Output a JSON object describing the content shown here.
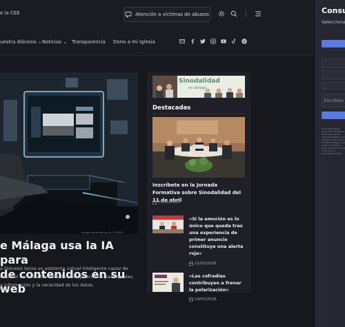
{
  "header": {
    "cee_link": "e la CEE",
    "victims_button": "Atención a víctimas de abusos"
  },
  "nav": {
    "items": [
      {
        "label": "uestra diócesis",
        "chevron": true
      },
      {
        "label": "Noticias",
        "chevron": true
      },
      {
        "label": "Transparencia",
        "chevron": false
      },
      {
        "label": "Dono a mi Iglesia",
        "chevron": false
      }
    ],
    "social_icons": [
      "mail-icon",
      "facebook-icon",
      "twitter-icon",
      "instagram-icon",
      "youtube-icon",
      "tiktok-icon",
      "spotify-icon"
    ]
  },
  "hero": {
    "image_credit": "Imagen generada con IA  ∕ FREEPIK",
    "headline_line1": "e Málaga usa la IA para",
    "headline_line2": "de contenidos en su web",
    "summary_line1": "a Diócesis lanza un asistente virtual inteligente capaz de",
    "summary_line2": "cilitar el acceso a horarios de misa y servicios parroquiales,",
    "summary_line3": "a información y la veracidad de los datos.",
    "author": "Ruiz"
  },
  "sidebar": {
    "banner_title": "Sinodalidad",
    "banner_subtitle": "en diálogo",
    "section_title": "Destacadas",
    "featured": {
      "title": "Inscríbete en la Jornada Formativa sobre Sinodalidad del 11 de abril",
      "date": "19/01/2026"
    },
    "news": [
      {
        "title": "«Si la emoción es lo único que queda tras una experiencia de primer anuncio constituye una alerta roja»",
        "date": "21/03/2026"
      },
      {
        "title": "«Las cofradías contribuyen a frenar la polarización»",
        "date": "19/03/2026"
      }
    ]
  },
  "side_panel": {
    "title": "Consu",
    "subtitle": "Selecciona",
    "input_placeholder": "Escribeto",
    "fine_print": "Aviso: Este asistente virtual utiliza inteligencia artificial para generar respuestas basadas en la información pública de la Diócesis de Málaga con el objetivo de facilitar el acceso a horarios de misa y servicios. Las respuestas generadas pueden contener errores; por favor, verifique la información con la parroquia o en los canales oficiales. En ningún caso las respuestas sustituyen la atención personal. No comparta datos personales sensibles. Más información en la web."
  },
  "colors": {
    "accent": "#5b7ae0",
    "background": "#17181d",
    "banner_text": "#5b8e6c"
  }
}
